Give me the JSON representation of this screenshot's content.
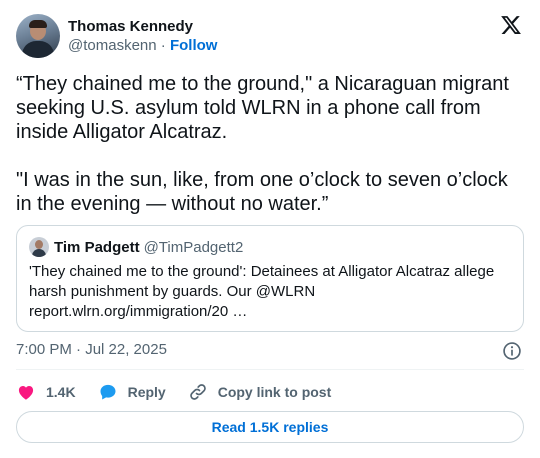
{
  "author": {
    "name": "Thomas Kennedy",
    "handle": "@tomaskenn",
    "separator": "·",
    "follow_label": "Follow"
  },
  "tweet": {
    "text": "“They chained me to the ground,\" a Nicaraguan migrant seeking U.S. asylum told WLRN in a phone call from inside Alligator Alcatraz.\n\n\"I was in the sun, like, from one o’clock to seven o’clock in the evening — without no water.”"
  },
  "quote": {
    "name": "Tim Padgett",
    "handle": "@TimPadgett2",
    "text": "'They chained me to the ground': Detainees at Alligator Alcatraz allege harsh punishment by guards. Our @WLRN report.wlrn.org/immigration/20 …"
  },
  "meta": {
    "timestamp": "7:00 PM · Jul 22, 2025"
  },
  "actions": {
    "like_count": "1.4K",
    "reply_label": "Reply",
    "copy_label": "Copy link to post"
  },
  "read_replies_label": "Read 1.5K replies",
  "colors": {
    "link": "#006fd6",
    "like": "#f91880",
    "reply_bubble": "#1d9bf0",
    "muted": "#536471",
    "border": "#cfd9de"
  },
  "icons": [
    "x-logo-icon",
    "heart-icon",
    "reply-bubble-icon",
    "link-icon",
    "info-icon"
  ]
}
